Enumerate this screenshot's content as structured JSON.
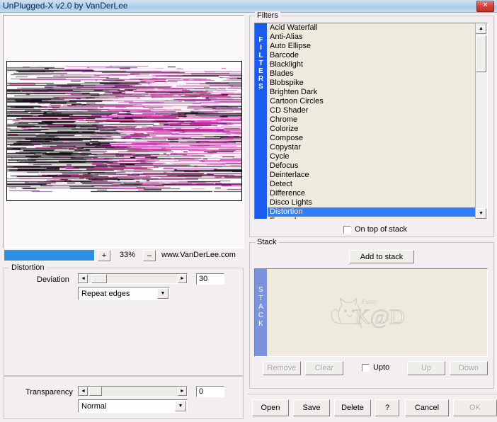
{
  "window": {
    "title": "UnPlugged-X v2.0 by VanDerLee",
    "close_label": "✕",
    "accent_blue": "#2f7ff5",
    "titlebar_color": "#b9d3ec"
  },
  "preview": {
    "zoom_percent": "33%",
    "zoom_in_label": "+",
    "zoom_out_label": "–",
    "website": "www.VanDerLee.com",
    "progress_percent": 100
  },
  "distortion": {
    "group_label": "Distortion",
    "deviation_label": "Deviation",
    "deviation_value": "30",
    "left_arrow": "◄",
    "right_arrow": "►",
    "edge_mode": "Repeat edges",
    "dropdown_arrow": "▼"
  },
  "transparency": {
    "label": "Transparency",
    "value": "0",
    "blend_mode": "Normal",
    "left_arrow": "◄",
    "right_arrow": "►",
    "dropdown_arrow": "▼"
  },
  "filters": {
    "group_label": "Filters",
    "strip_label": "FILTERS",
    "selected": "Distortion",
    "scroll_up": "▲",
    "scroll_down": "▼",
    "on_top_of_stack": {
      "label": "On top of stack",
      "checked": false
    },
    "items": [
      "Acid Waterfall",
      "Anti-Alias",
      "Auto Ellipse",
      "Barcode",
      "Blacklight",
      "Blades",
      "Blobspike",
      "Brighten Dark",
      "Cartoon Circles",
      "CD Shader",
      "Chrome",
      "Colorize",
      "Compose",
      "Copystar",
      "Cycle",
      "Defocus",
      "Deinterlace",
      "Detect",
      "Difference",
      "Disco Lights",
      "Distortion",
      "Expand"
    ]
  },
  "stack": {
    "group_label": "Stack",
    "strip_label": "STACK",
    "add_label": "Add to stack",
    "items": [],
    "watermark_text": "K@D",
    "watermark_sub": "Fuzzy",
    "buttons": {
      "remove": "Remove",
      "clear": "Clear",
      "up": "Up",
      "down": "Down"
    },
    "upto": {
      "label": "Upto",
      "checked": false
    }
  },
  "bottom_buttons": [
    {
      "label": "Open",
      "disabled": false
    },
    {
      "label": "Save",
      "disabled": false
    },
    {
      "label": "Delete",
      "disabled": false
    },
    {
      "label": "?",
      "disabled": false
    },
    {
      "label": "Cancel",
      "disabled": false
    },
    {
      "label": "OK",
      "disabled": true
    }
  ]
}
